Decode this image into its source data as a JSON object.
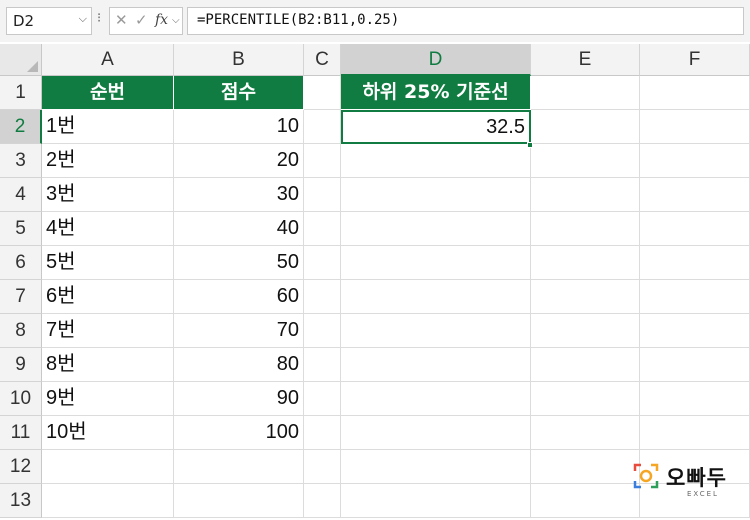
{
  "formula_bar": {
    "name_box": "D2",
    "name_dropdown_icon": "chevron-down-icon",
    "menu_dots": "⁝",
    "cancel_icon": "✕",
    "enter_icon": "✓",
    "fx_label": "fx",
    "formula": "=PERCENTILE(B2:B11,0.25)"
  },
  "columns": [
    "A",
    "B",
    "C",
    "D",
    "E",
    "F"
  ],
  "rows": [
    "1",
    "2",
    "3",
    "4",
    "5",
    "6",
    "7",
    "8",
    "9",
    "10",
    "11",
    "12",
    "13"
  ],
  "header_row": {
    "a": "순번",
    "b": "점수",
    "d": "하위 25% 기준선"
  },
  "data_rows": [
    {
      "a": "1번",
      "b": "10"
    },
    {
      "a": "2번",
      "b": "20"
    },
    {
      "a": "3번",
      "b": "30"
    },
    {
      "a": "4번",
      "b": "40"
    },
    {
      "a": "5번",
      "b": "50"
    },
    {
      "a": "6번",
      "b": "60"
    },
    {
      "a": "7번",
      "b": "70"
    },
    {
      "a": "8번",
      "b": "80"
    },
    {
      "a": "9번",
      "b": "90"
    },
    {
      "a": "10번",
      "b": "100"
    }
  ],
  "result": {
    "d2": "32.5"
  },
  "logo": {
    "text": "오빠두",
    "sub": "EXCEL"
  },
  "colors": {
    "accent": "#117c41",
    "header_fill": "#117c41",
    "header_text": "#ffffff"
  }
}
